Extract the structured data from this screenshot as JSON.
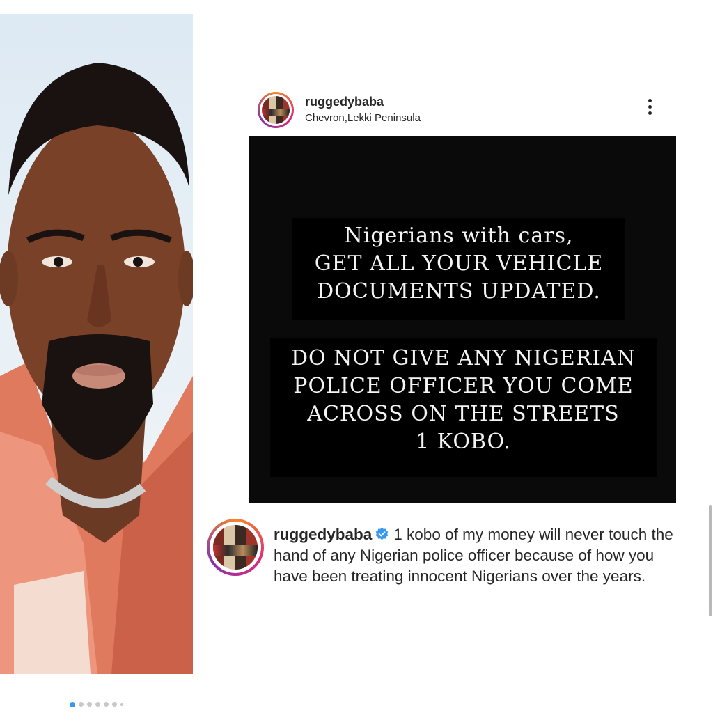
{
  "post": {
    "username": "ruggedybaba",
    "location": "Chevron,Lekki Peninsula",
    "image_text": {
      "block1": [
        "Nigerians with cars,",
        "GET ALL YOUR VEHICLE",
        "DOCUMENTS UPDATED."
      ],
      "block2": [
        "DO NOT GIVE ANY NIGERIAN",
        "POLICE OFFICER YOU COME",
        "ACROSS ON THE STREETS",
        "1 KOBO."
      ]
    }
  },
  "caption": {
    "username": "ruggedybaba",
    "text": "1 kobo of my money will never touch the hand of any Nigerian police officer because of how you have been treating innocent Nigerians over the years."
  },
  "icons": {
    "menu": "more-vertical-icon",
    "verified": "verified-badge-icon"
  },
  "colors": {
    "verified_blue": "#3897f0",
    "text": "#262626",
    "image_bg": "#0b0a0a"
  },
  "carousel": {
    "total_dots": 7,
    "active_index": 0
  }
}
